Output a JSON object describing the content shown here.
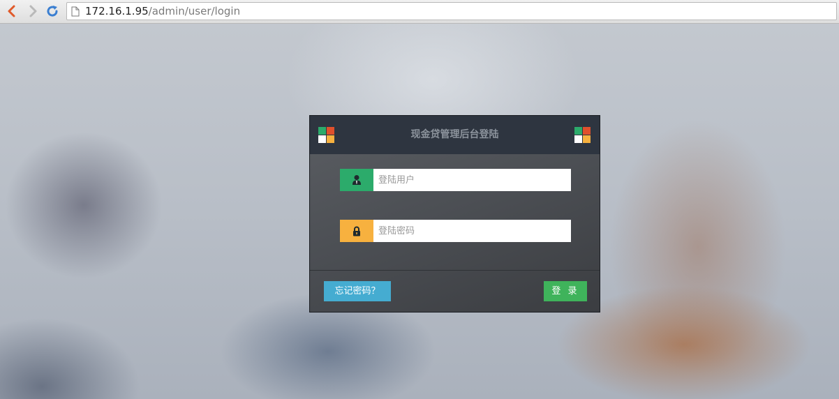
{
  "browser": {
    "url_host": "172.16.1.95",
    "url_path": "/admin/user/login",
    "icons": [
      "back-arrow-icon",
      "forward-arrow-icon",
      "reload-icon",
      "page-icon"
    ]
  },
  "login": {
    "title": "现金贷管理后台登陆",
    "username_placeholder": "登陆用户",
    "password_placeholder": "登陆密码",
    "forgot_label": "忘记密码？",
    "login_label": "登 录",
    "icons": [
      "user-icon",
      "lock-icon",
      "logo-icon"
    ]
  },
  "colors": {
    "header_bg": "#2e3540",
    "user_icon_bg": "#2cab6b",
    "lock_icon_bg": "#f7b13f",
    "forgot_button": "#45acd1",
    "login_button": "#3fb35b",
    "logo_green": "#2cab6b",
    "logo_red": "#e0502c",
    "logo_white": "#ffffff",
    "logo_yellow": "#f7b13f"
  }
}
